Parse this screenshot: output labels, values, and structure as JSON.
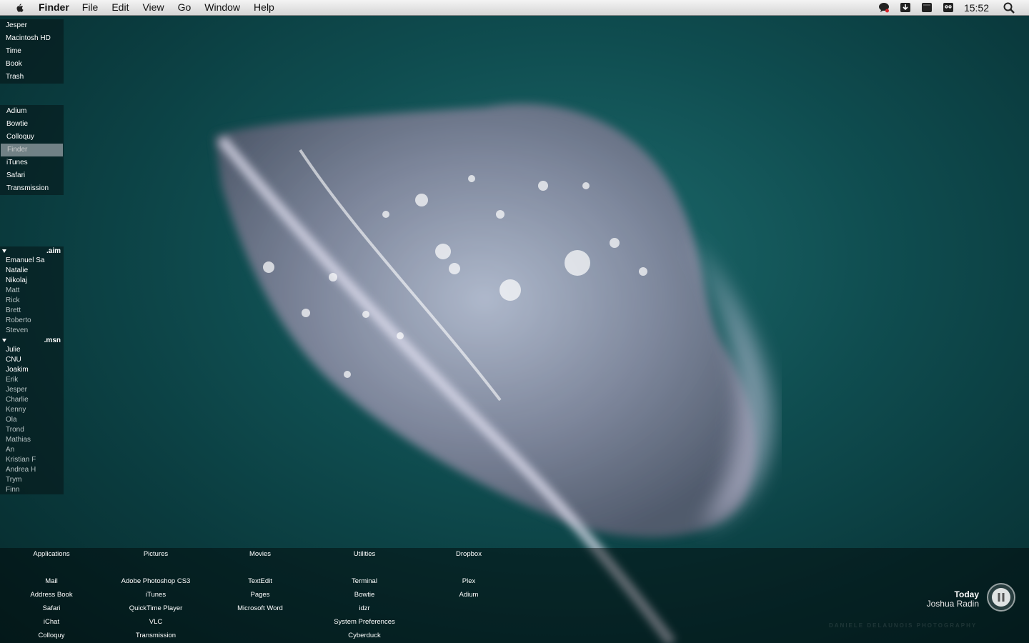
{
  "menubar": {
    "app_name": "Finder",
    "items": [
      "File",
      "Edit",
      "View",
      "Go",
      "Window",
      "Help"
    ],
    "status_icons": [
      "chat-bubble-icon",
      "download-icon",
      "window-icon",
      "owl-icon"
    ],
    "clock": "15:52"
  },
  "places": [
    "Jesper",
    "Macintosh HD",
    "Time",
    "Book",
    "Trash"
  ],
  "apps": {
    "items": [
      "Adium",
      "Bowtie",
      "Colloquy",
      "Finder",
      "iTunes",
      "Safari",
      "Transmission"
    ],
    "selected": "Finder"
  },
  "buddies": {
    "groups": [
      {
        "name": ".aim",
        "members": [
          {
            "name": "Emanuel Sa",
            "status": "online"
          },
          {
            "name": "Natalie",
            "status": "online"
          },
          {
            "name": "Nikolaj",
            "status": "online"
          },
          {
            "name": "Matt",
            "status": "away"
          },
          {
            "name": "Rick",
            "status": "away"
          },
          {
            "name": "Brett",
            "status": "away"
          },
          {
            "name": "Roberto",
            "status": "away"
          },
          {
            "name": "Steven",
            "status": "away"
          }
        ]
      },
      {
        "name": ".msn",
        "members": [
          {
            "name": "Julie",
            "status": "online"
          },
          {
            "name": "CNU",
            "status": "online"
          },
          {
            "name": "Joakim",
            "status": "online"
          },
          {
            "name": "Erik",
            "status": "away"
          },
          {
            "name": "Jesper",
            "status": "away"
          },
          {
            "name": "Charlie",
            "status": "away"
          },
          {
            "name": "Kenny",
            "status": "away"
          },
          {
            "name": "Ola",
            "status": "away"
          },
          {
            "name": "Trond",
            "status": "away"
          },
          {
            "name": "Mathias",
            "status": "away"
          },
          {
            "name": "An",
            "status": "away"
          },
          {
            "name": "Kristian F",
            "status": "away"
          },
          {
            "name": "Andrea H",
            "status": "away"
          },
          {
            "name": "Trym",
            "status": "away"
          },
          {
            "name": "Finn",
            "status": "away"
          }
        ]
      }
    ]
  },
  "shelf": [
    {
      "heading": "Applications",
      "items": [
        "Mail",
        "Address Book",
        "Safari",
        "iChat",
        "Colloquy"
      ]
    },
    {
      "heading": "Pictures",
      "items": [
        "Adobe Photoshop CS3",
        "iTunes",
        "QuickTime Player",
        "VLC",
        "Transmission"
      ]
    },
    {
      "heading": "Movies",
      "items": [
        "TextEdit",
        "Pages",
        "Microsoft Word"
      ]
    },
    {
      "heading": "Utilities",
      "items": [
        "Terminal",
        "Bowtie",
        "idzr",
        "System Preferences",
        "Cyberduck"
      ]
    },
    {
      "heading": "Dropbox",
      "items": [
        "Plex",
        "Adium"
      ]
    }
  ],
  "now_playing": {
    "track": "Today",
    "artist": "Joshua Radin"
  },
  "watermark": "DANIELE DELAUNOIS PHOTOGRAPHY"
}
